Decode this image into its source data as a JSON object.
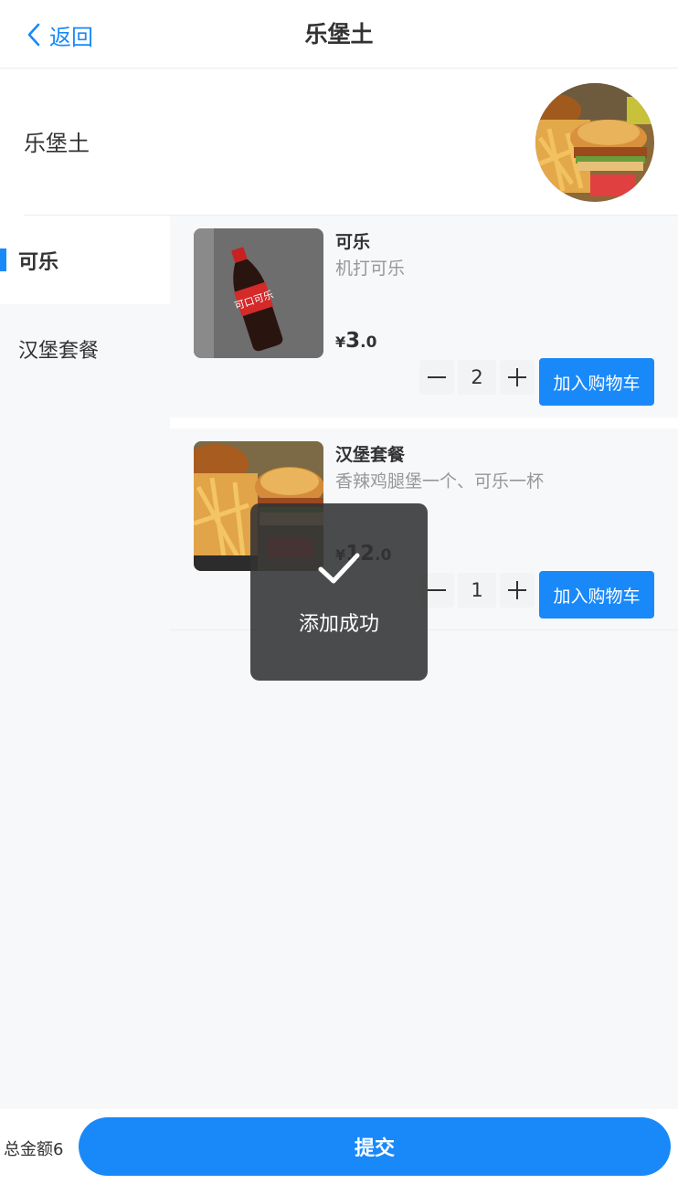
{
  "nav": {
    "back_label": "返回",
    "title": "乐堡土"
  },
  "shop": {
    "name": "乐堡土"
  },
  "sidebar": {
    "items": [
      {
        "label": "可乐",
        "active": true
      },
      {
        "label": "汉堡套餐",
        "active": false
      }
    ]
  },
  "goods": [
    {
      "name": "可乐",
      "desc": "机打可乐",
      "price_symbol": "¥",
      "price_int": "3",
      "price_dec": ".0",
      "quantity": "2",
      "add_label": "加入购物车"
    },
    {
      "name": "汉堡套餐",
      "desc": "香辣鸡腿堡一个、可乐一杯",
      "price_symbol": "¥",
      "price_int": "12",
      "price_dec": ".0",
      "quantity": "1",
      "add_label": "加入购物车"
    }
  ],
  "toast": {
    "text": "添加成功"
  },
  "submit_bar": {
    "total_label": "总金额6",
    "submit_label": "提交"
  },
  "colors": {
    "accent": "#1989fa",
    "toast_bg": "#323233"
  }
}
